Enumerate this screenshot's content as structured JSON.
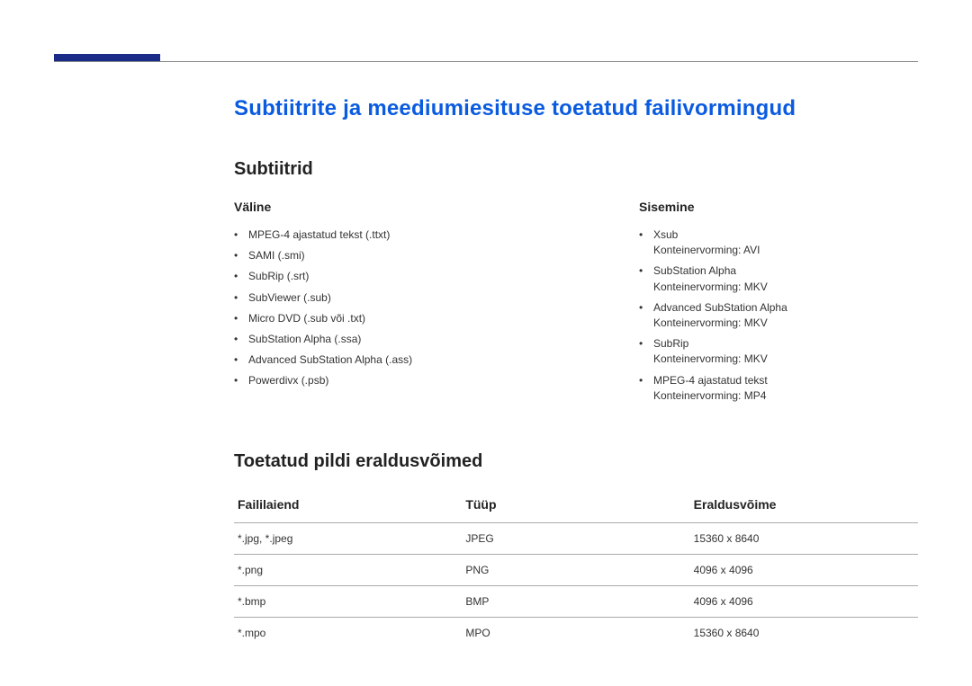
{
  "title": "Subtiitrite ja meediumiesituse toetatud failivormingud",
  "subtitles": {
    "heading": "Subtiitrid",
    "external": {
      "heading": "Väline",
      "items": [
        "MPEG-4 ajastatud tekst (.ttxt)",
        "SAMI (.smi)",
        "SubRip (.srt)",
        "SubViewer (.sub)",
        "Micro DVD (.sub või .txt)",
        "SubStation Alpha (.ssa)",
        "Advanced SubStation Alpha (.ass)",
        "Powerdivx (.psb)"
      ]
    },
    "internal": {
      "heading": "Sisemine",
      "items": [
        {
          "name": "Xsub",
          "container": "Konteinervorming: AVI"
        },
        {
          "name": "SubStation Alpha",
          "container": "Konteinervorming: MKV"
        },
        {
          "name": "Advanced SubStation Alpha",
          "container": "Konteinervorming: MKV"
        },
        {
          "name": "SubRip",
          "container": "Konteinervorming: MKV"
        },
        {
          "name": "MPEG-4 ajastatud tekst",
          "container": "Konteinervorming: MP4"
        }
      ]
    }
  },
  "resolutions": {
    "heading": "Toetatud pildi eraldusvõimed",
    "headers": {
      "ext": "Faililaiend",
      "type": "Tüüp",
      "res": "Eraldusvõime"
    },
    "rows": [
      {
        "ext": "*.jpg, *.jpeg",
        "type": "JPEG",
        "res": "15360 x 8640"
      },
      {
        "ext": "*.png",
        "type": "PNG",
        "res": "4096 x 4096"
      },
      {
        "ext": "*.bmp",
        "type": "BMP",
        "res": "4096 x 4096"
      },
      {
        "ext": "*.mpo",
        "type": "MPO",
        "res": "15360 x 8640"
      }
    ]
  }
}
